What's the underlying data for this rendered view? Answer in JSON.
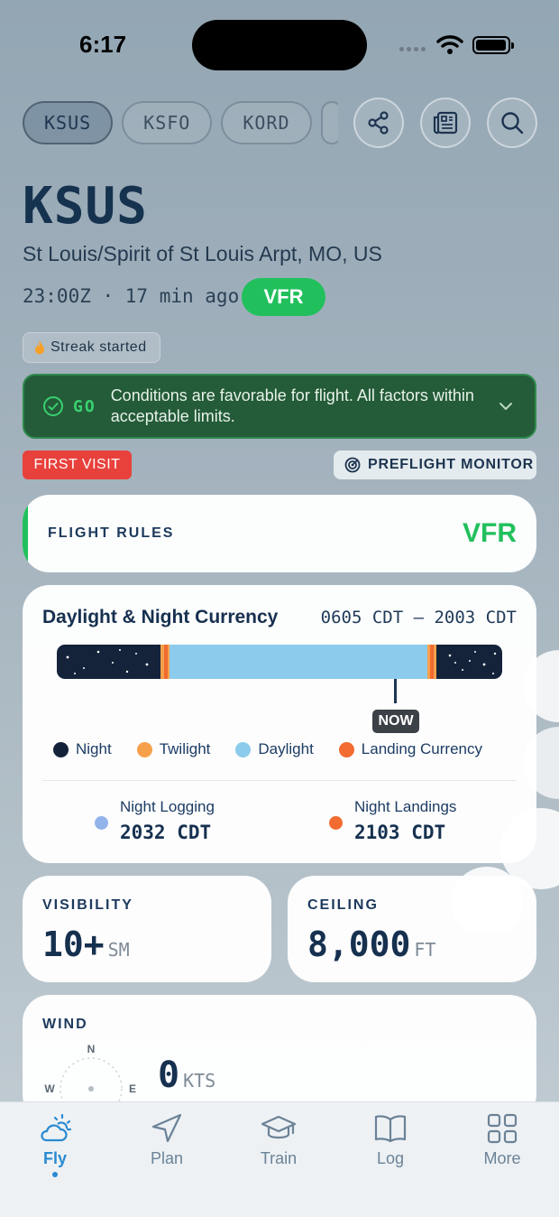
{
  "status_bar": {
    "time": "6:17"
  },
  "airports": {
    "chips": [
      "KSUS",
      "KSFO",
      "KORD"
    ],
    "active": "KSUS"
  },
  "header": {
    "code": "KSUS",
    "name": "St Louis/Spirit of St Louis Arpt, MO, US",
    "obs_time": "23:00Z · 17 min ago",
    "category": "VFR"
  },
  "streak": {
    "label": "Streak started"
  },
  "go_banner": {
    "label": "GO",
    "message": "Conditions are favorable for flight. All factors within acceptable limits."
  },
  "badges": {
    "first_visit": "FIRST VISIT",
    "preflight": "PREFLIGHT MONITOR"
  },
  "flight_rules": {
    "label": "FLIGHT RULES",
    "value": "VFR"
  },
  "daylight": {
    "title": "Daylight & Night Currency",
    "range": "0605 CDT – 2003 CDT",
    "now_label": "NOW",
    "legend": [
      {
        "label": "Night",
        "color": "#14233a"
      },
      {
        "label": "Twilight",
        "color": "#f7a04b"
      },
      {
        "label": "Daylight",
        "color": "#8ccbec"
      },
      {
        "label": "Landing Currency",
        "color": "#f26b30"
      }
    ],
    "night_logging": {
      "label": "Night Logging",
      "value": "2032 CDT"
    },
    "night_landings": {
      "label": "Night Landings",
      "value": "2103 CDT"
    }
  },
  "visibility": {
    "label": "VISIBILITY",
    "value": "10+",
    "unit": "SM"
  },
  "ceiling": {
    "label": "CEILING",
    "value": "8,000",
    "unit": "FT"
  },
  "wind": {
    "label": "WIND",
    "value": "0",
    "unit": "KTS",
    "compass": {
      "n": "N",
      "e": "E",
      "w": "W"
    }
  },
  "tabs": [
    {
      "label": "Fly",
      "active": true
    },
    {
      "label": "Plan"
    },
    {
      "label": "Train"
    },
    {
      "label": "Log"
    },
    {
      "label": "More"
    }
  ]
}
